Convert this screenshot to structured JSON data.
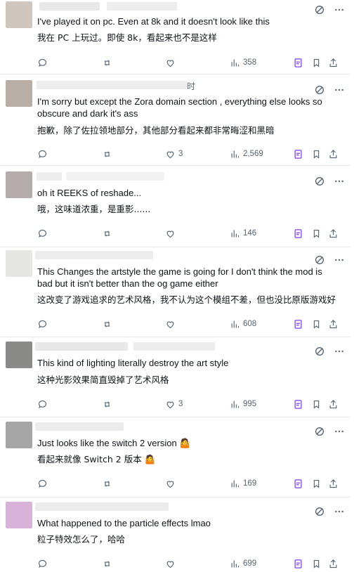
{
  "replies": [
    {
      "avatar_color": "#cfc6bd",
      "text": "I've played it on pc. Even at 8k and it doesn't look like this",
      "translation": "我在 PC 上玩过。即使 8k，看起来也不是这样",
      "likes": "",
      "views": "358"
    },
    {
      "avatar_color": "#b9aea6",
      "text": "I'm sorry but except the Zora domain section , everything else looks so obscure and dark it's ass",
      "translation": "抱歉，除了佐拉领地部分，其他部分看起来都非常晦涩和黑暗",
      "likes": "3",
      "views": "2,569",
      "tail": "时"
    },
    {
      "avatar_color": "#b3acaa",
      "text": "oh it REEKS of reshade...",
      "translation": "哦，这味道浓重，是重影......",
      "likes": "",
      "views": "146"
    },
    {
      "avatar_color": "#e6e7e3",
      "text": "This Changes the artstyle the game is going for I don't think the mod is bad but it isn't better than the og game either",
      "translation": "这改变了游戏追求的艺术风格，我不认为这个模组不差，但也没比原版游戏好",
      "likes": "",
      "views": "608"
    },
    {
      "avatar_color": "#8a8a89",
      "text": "This kind of lighting literally destroy the art style",
      "translation": "这种光影效果简直毁掉了艺术风格",
      "likes": "3",
      "views": "995"
    },
    {
      "avatar_color": "#a6a6a6",
      "text": "Just looks like the switch 2 version 🤷",
      "translation": "看起来就像 Switch 2 版本 🤷",
      "likes": "",
      "views": "169"
    },
    {
      "avatar_color": "#d8b2d8",
      "text": "What happened to the particle effects lmao",
      "translation": "粒子特效怎么了，哈哈",
      "likes": "",
      "views": "699"
    }
  ],
  "icons": {
    "reply": "reply-icon",
    "repost": "repost-icon",
    "like": "like-icon",
    "views": "views-icon",
    "grok": "grok-icon",
    "bookmark": "bookmark-icon",
    "share": "share-icon",
    "more": "more-icon"
  }
}
